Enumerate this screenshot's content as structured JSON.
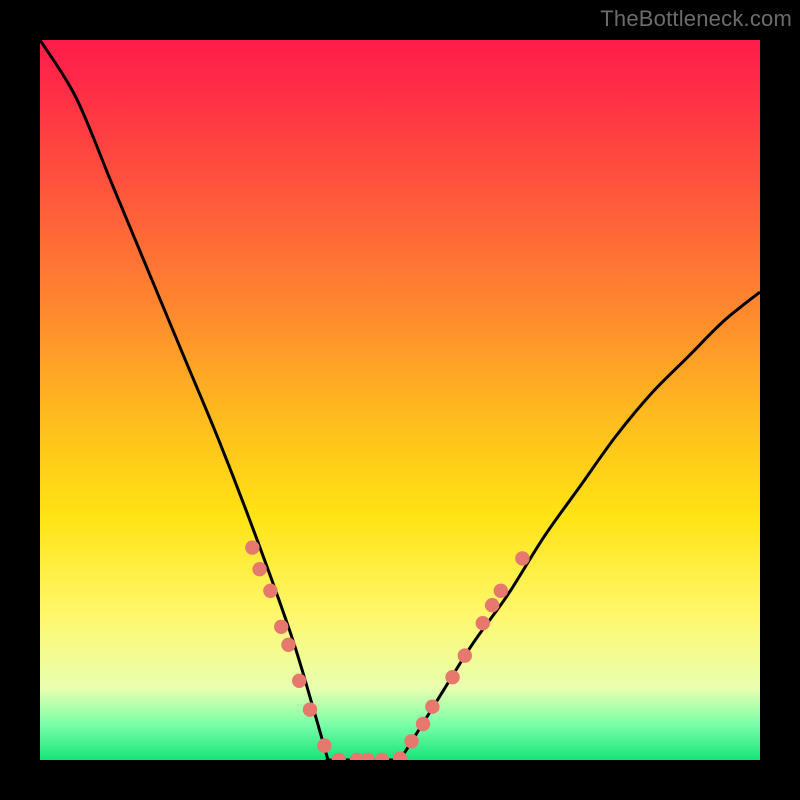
{
  "watermark": "TheBottleneck.com",
  "chart_data": {
    "type": "line",
    "title": "",
    "xlabel": "",
    "ylabel": "",
    "xlim": [
      0,
      1
    ],
    "ylim": [
      0,
      1
    ],
    "background_gradient": {
      "direction": "top-to-bottom",
      "stops": [
        {
          "pos": 0.0,
          "color": "#ff1c4b"
        },
        {
          "pos": 0.08,
          "color": "#ff3045"
        },
        {
          "pos": 0.22,
          "color": "#ff593b"
        },
        {
          "pos": 0.38,
          "color": "#ff8a2e"
        },
        {
          "pos": 0.52,
          "color": "#ffba1e"
        },
        {
          "pos": 0.66,
          "color": "#ffe313"
        },
        {
          "pos": 0.8,
          "color": "#fff86e"
        },
        {
          "pos": 0.9,
          "color": "#e8ffb0"
        },
        {
          "pos": 0.95,
          "color": "#7bffa9"
        },
        {
          "pos": 1.0,
          "color": "#16e47a"
        }
      ]
    },
    "series": [
      {
        "name": "left-branch",
        "stroke": "#000000",
        "x": [
          0.0,
          0.05,
          0.1,
          0.15,
          0.2,
          0.25,
          0.3,
          0.35,
          0.38,
          0.4
        ],
        "y": [
          1.0,
          0.92,
          0.8,
          0.68,
          0.56,
          0.44,
          0.31,
          0.17,
          0.07,
          0.0
        ]
      },
      {
        "name": "valley-floor",
        "stroke": "#000000",
        "x": [
          0.4,
          0.44,
          0.48,
          0.5
        ],
        "y": [
          0.0,
          0.0,
          0.0,
          0.0
        ]
      },
      {
        "name": "right-branch",
        "stroke": "#000000",
        "x": [
          0.5,
          0.55,
          0.6,
          0.65,
          0.7,
          0.75,
          0.8,
          0.85,
          0.9,
          0.95,
          1.0
        ],
        "y": [
          0.0,
          0.08,
          0.16,
          0.23,
          0.31,
          0.38,
          0.45,
          0.51,
          0.56,
          0.61,
          0.65
        ]
      }
    ],
    "markers": {
      "name": "salmon-dots",
      "fill": "#e7786e",
      "radius": 10,
      "points": [
        {
          "x": 0.295,
          "y": 0.295
        },
        {
          "x": 0.305,
          "y": 0.265
        },
        {
          "x": 0.32,
          "y": 0.235
        },
        {
          "x": 0.335,
          "y": 0.185
        },
        {
          "x": 0.345,
          "y": 0.16
        },
        {
          "x": 0.36,
          "y": 0.11
        },
        {
          "x": 0.375,
          "y": 0.07
        },
        {
          "x": 0.395,
          "y": 0.02
        },
        {
          "x": 0.415,
          "y": 0.0
        },
        {
          "x": 0.44,
          "y": 0.0
        },
        {
          "x": 0.455,
          "y": 0.0
        },
        {
          "x": 0.475,
          "y": 0.0
        },
        {
          "x": 0.5,
          "y": 0.002
        },
        {
          "x": 0.516,
          "y": 0.026
        },
        {
          "x": 0.532,
          "y": 0.05
        },
        {
          "x": 0.545,
          "y": 0.074
        },
        {
          "x": 0.573,
          "y": 0.115
        },
        {
          "x": 0.59,
          "y": 0.145
        },
        {
          "x": 0.615,
          "y": 0.19
        },
        {
          "x": 0.628,
          "y": 0.215
        },
        {
          "x": 0.64,
          "y": 0.235
        },
        {
          "x": 0.67,
          "y": 0.28
        }
      ]
    }
  }
}
